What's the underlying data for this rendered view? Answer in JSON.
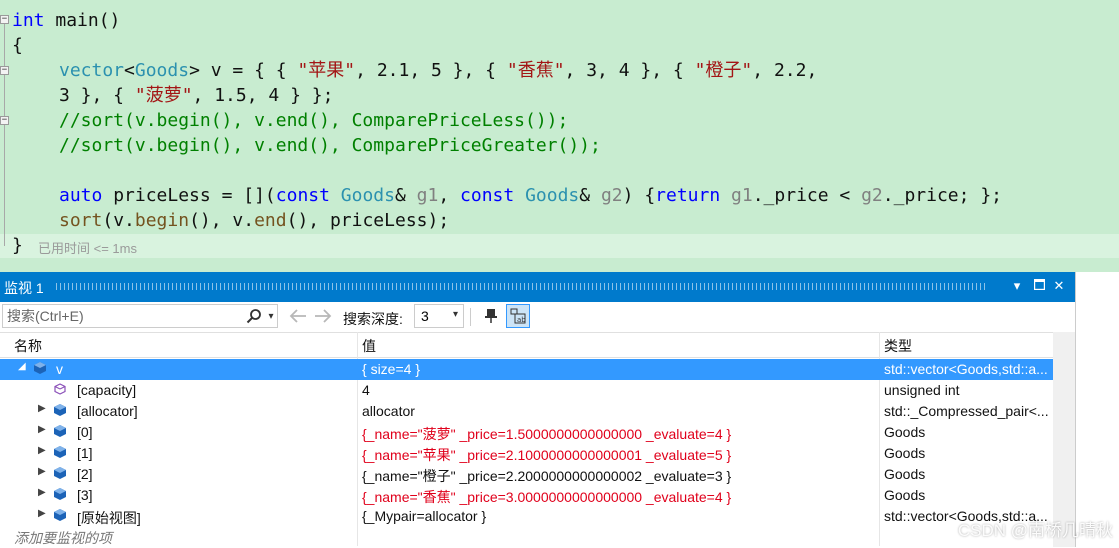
{
  "editor": {
    "lines": {
      "l1": {
        "kw": "int",
        "rest": " main()"
      },
      "l2": "{",
      "l3": {
        "type1": "vector",
        "lt": "<",
        "type2": "Goods",
        "gt": ">",
        "pre": " v = { { ",
        "s1": "\"苹果\"",
        "a1": ", 2.1, 5 }, { ",
        "s2": "\"香蕉\"",
        "a2": ", 3, 4 }, { ",
        "s3": "\"橙子\"",
        "a3": ", 2.2,"
      },
      "l4": {
        "pre": "3 }, { ",
        "s4": "\"菠萝\"",
        "post": ", 1.5, 4 } };"
      },
      "l5": "//sort(v.begin(), v.end(), ComparePriceLess());",
      "l6": "//sort(v.begin(), v.end(), ComparePriceGreater());",
      "l8": {
        "auto": "auto",
        "var": " priceLess",
        "eq": " = [](",
        "const1": "const",
        "sp1": " ",
        "goods1": "Goods",
        "amp1": "& ",
        "g1": "g1",
        "comma": ", ",
        "const2": "const",
        "sp2": " ",
        "goods2": "Goods",
        "amp2": "& ",
        "g2": "g2",
        "paren": ") {",
        "ret": "return",
        "sp3": " ",
        "g1b": "g1",
        "p1": "._price < ",
        "g2b": "g2",
        "p2": "._price; };"
      },
      "l9": {
        "fn": "sort",
        "open": "(v.",
        "begin": "begin",
        "mid": "(), v.",
        "end": "end",
        "tail": "(), priceLess);"
      },
      "l10": "}"
    },
    "timing_hint": "已用时间 <= 1ms"
  },
  "watch": {
    "title": "监视 1",
    "search_placeholder": "搜索(Ctrl+E)",
    "depth_label": "搜索深度:",
    "depth_value": "3",
    "columns": {
      "name": "名称",
      "value": "值",
      "type": "类型"
    },
    "rows": [
      {
        "name": "v",
        "value": "{ size=4 }",
        "type": "std::vector<Goods,std::a..."
      },
      {
        "name": "[capacity]",
        "value": "4",
        "type": "unsigned int"
      },
      {
        "name": "[allocator]",
        "value": "allocator",
        "type": "std::_Compressed_pair<..."
      },
      {
        "name": "[0]",
        "value": "{_name=\"菠萝\" _price=1.5000000000000000 _evaluate=4 }",
        "type": "Goods"
      },
      {
        "name": "[1]",
        "value": "{_name=\"苹果\" _price=2.1000000000000001 _evaluate=5 }",
        "type": "Goods"
      },
      {
        "name": "[2]",
        "value": "{_name=\"橙子\" _price=2.2000000000000002 _evaluate=3 }",
        "type": "Goods"
      },
      {
        "name": "[3]",
        "value": "{_name=\"香蕉\" _price=3.0000000000000000 _evaluate=4 }",
        "type": "Goods"
      },
      {
        "name": "[原始视图]",
        "value": "{_Mypair=allocator }",
        "type": "std::vector<Goods,std::a..."
      }
    ],
    "add_watch": "添加要监视的项"
  },
  "watermark": "CSDN @南桥几晴秋",
  "colors": {
    "editor_bg": "#c8ecd0",
    "titlebar": "#007acc",
    "selection": "#3399ff",
    "changed_value": "#e0001b",
    "keyword": "#0000ff",
    "type": "#2b91af",
    "string": "#a31515",
    "comment": "#008000"
  }
}
